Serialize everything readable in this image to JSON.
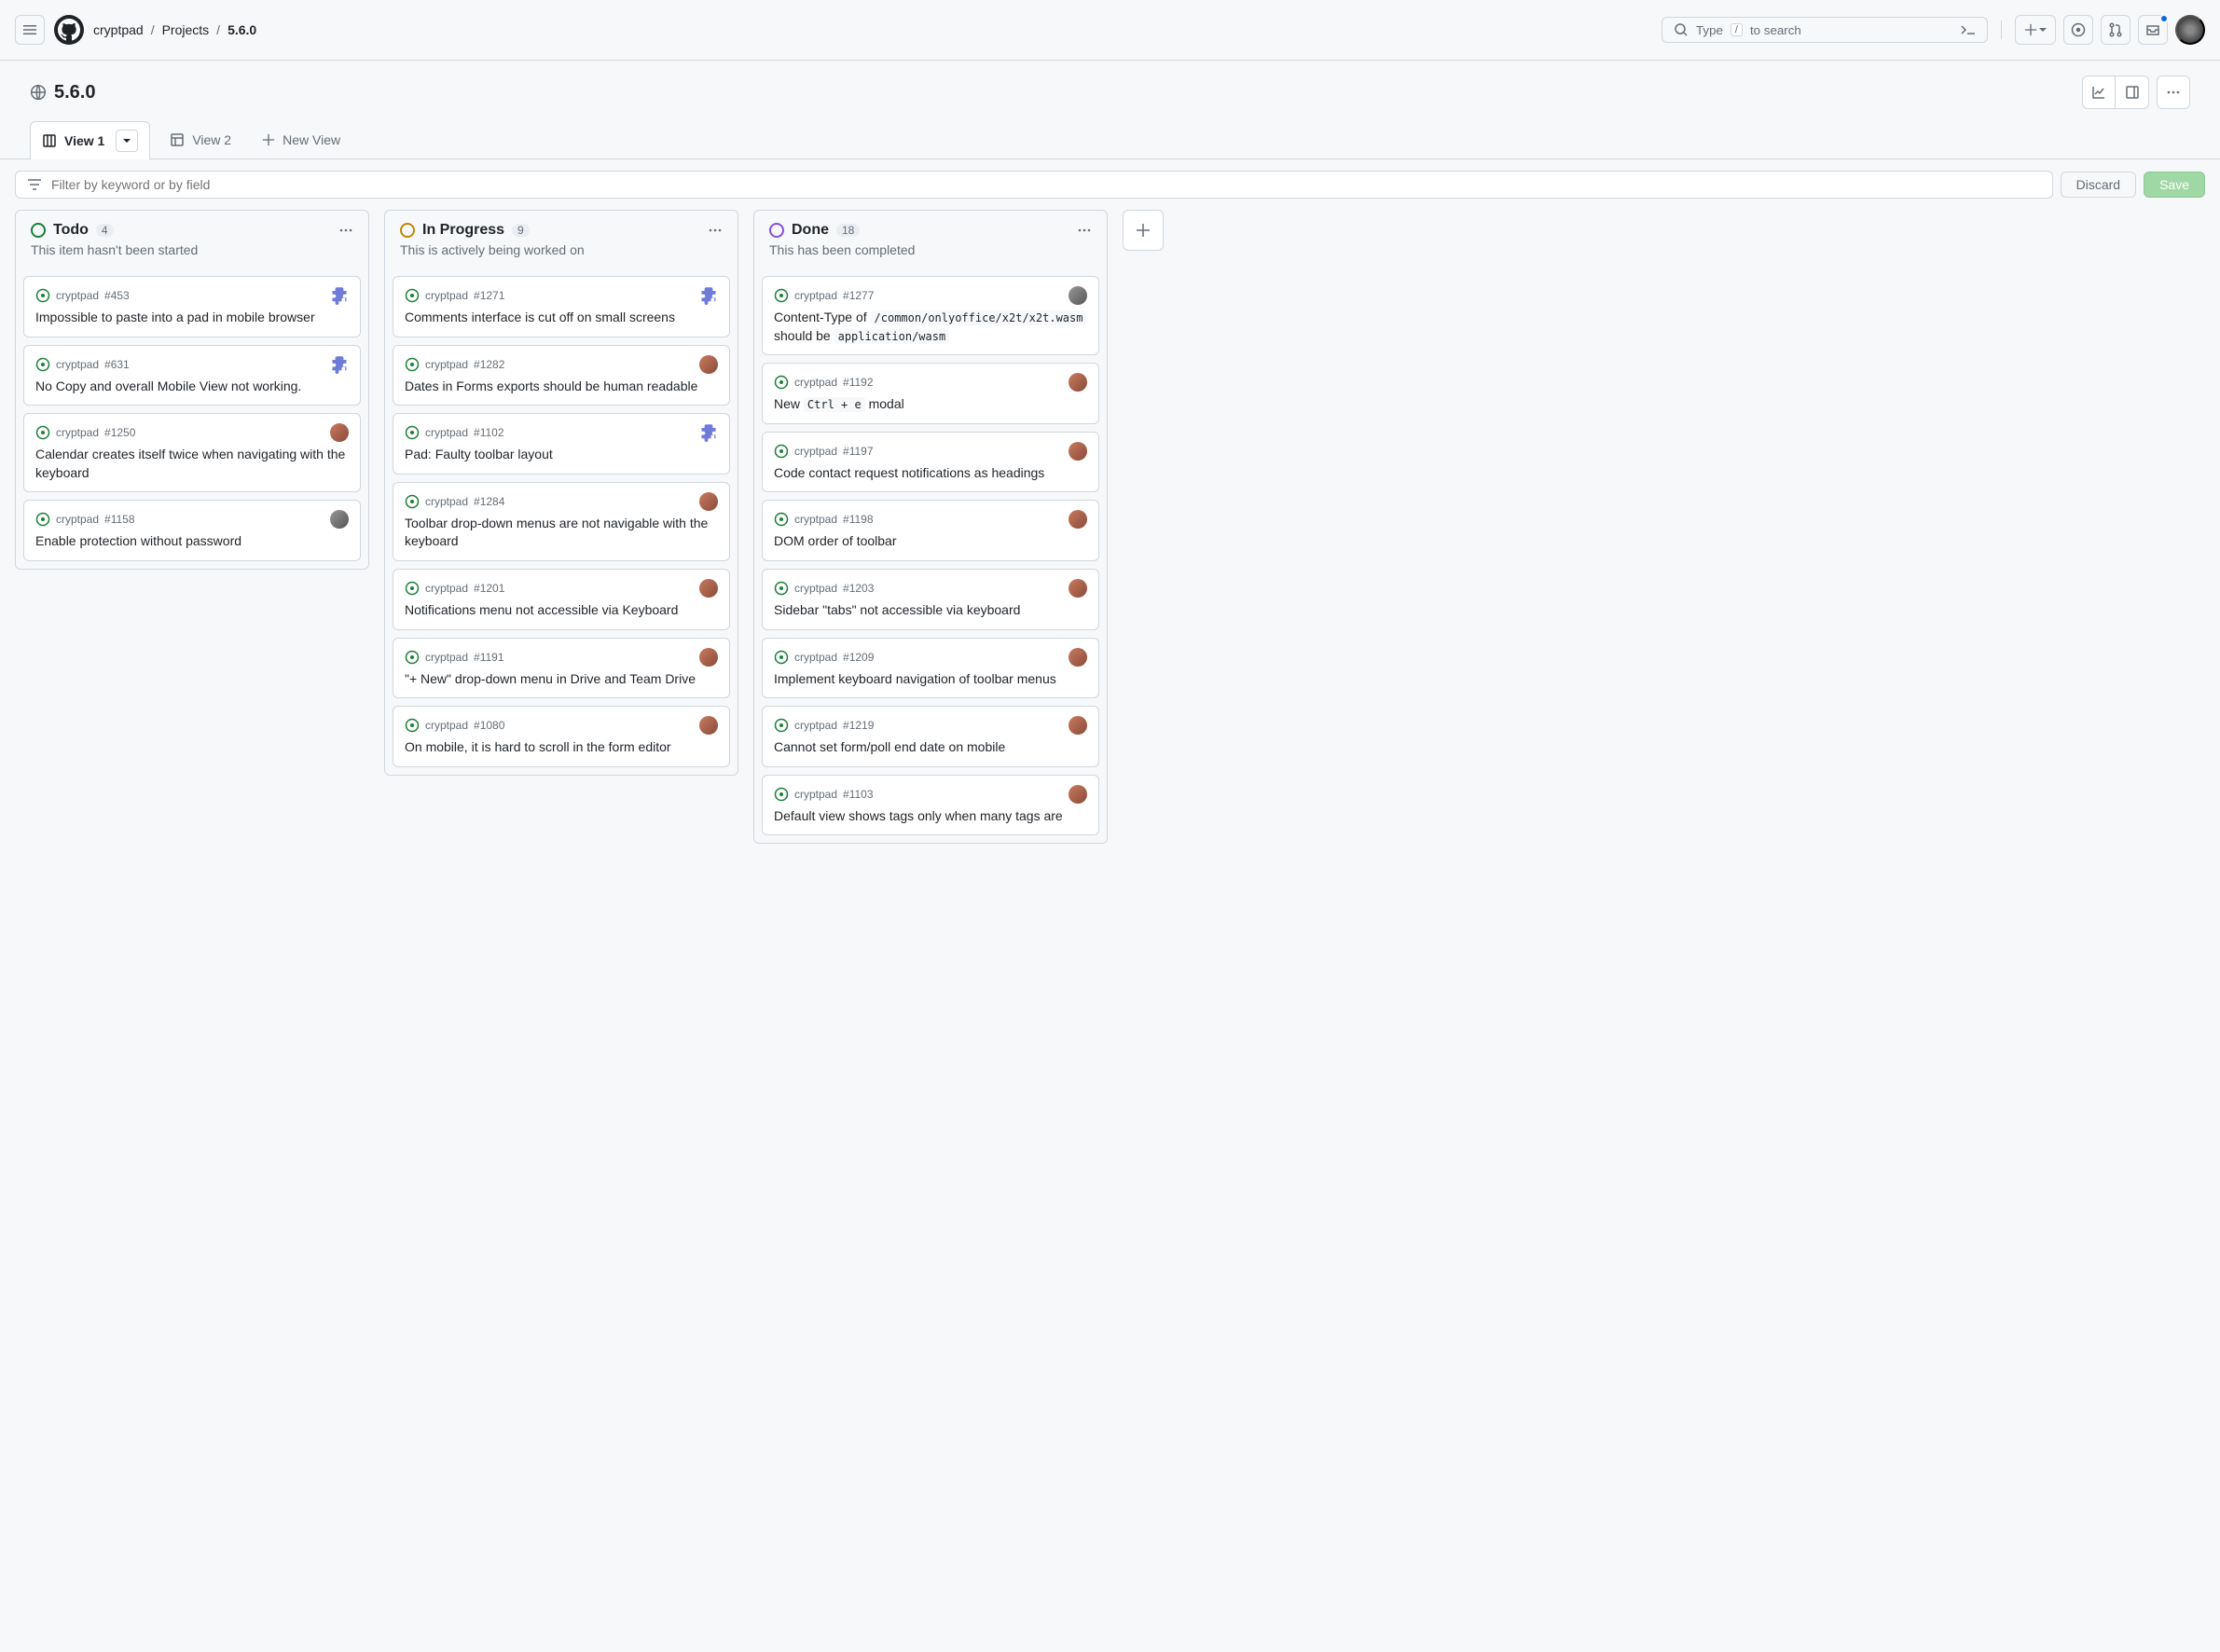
{
  "header": {
    "search_prefix": "Type",
    "search_suffix": "to search",
    "search_key": "/"
  },
  "breadcrumb": {
    "repo": "cryptpad",
    "section": "Projects",
    "current": "5.6.0"
  },
  "project": {
    "title": "5.6.0"
  },
  "tabs": {
    "view1": "View 1",
    "view2": "View 2",
    "new": "New View"
  },
  "filter": {
    "placeholder": "Filter by keyword or by field",
    "discard": "Discard",
    "save": "Save"
  },
  "columns": [
    {
      "id": "todo",
      "title": "Todo",
      "count": "4",
      "desc": "This item hasn't been started",
      "status_class": "sc-todo",
      "cards": [
        {
          "repo": "cryptpad",
          "num": "#453",
          "title": "Impossible to paste into a pad in mobile browser",
          "badge": "puzzle"
        },
        {
          "repo": "cryptpad",
          "num": "#631",
          "title": "No Copy and overall Mobile View not working.",
          "badge": "puzzle"
        },
        {
          "repo": "cryptpad",
          "num": "#1250",
          "title": "Calendar creates itself twice when navigating with the keyboard",
          "badge": "assignee"
        },
        {
          "repo": "cryptpad",
          "num": "#1158",
          "title": "Enable protection without password",
          "badge": "assignee-gray"
        }
      ]
    },
    {
      "id": "progress",
      "title": "In Progress",
      "count": "9",
      "desc": "This is actively being worked on",
      "status_class": "sc-progress",
      "cards": [
        {
          "repo": "cryptpad",
          "num": "#1271",
          "title": "Comments interface is cut off on small screens",
          "badge": "puzzle"
        },
        {
          "repo": "cryptpad",
          "num": "#1282",
          "title": "Dates in Forms exports should be human readable",
          "badge": "assignee"
        },
        {
          "repo": "cryptpad",
          "num": "#1102",
          "title": "Pad: Faulty toolbar layout",
          "badge": "puzzle"
        },
        {
          "repo": "cryptpad",
          "num": "#1284",
          "title": "Toolbar drop-down menus are not navigable with the keyboard",
          "badge": "assignee"
        },
        {
          "repo": "cryptpad",
          "num": "#1201",
          "title": "Notifications menu not accessible via Keyboard",
          "badge": "assignee"
        },
        {
          "repo": "cryptpad",
          "num": "#1191",
          "title": "\"+ New\" drop-down menu in Drive and Team Drive",
          "badge": "assignee"
        },
        {
          "repo": "cryptpad",
          "num": "#1080",
          "title": "On mobile, it is hard to scroll in the form editor",
          "badge": "assignee"
        }
      ]
    },
    {
      "id": "done",
      "title": "Done",
      "count": "18",
      "desc": "This has been completed",
      "status_class": "sc-done",
      "cards": [
        {
          "repo": "cryptpad",
          "num": "#1277",
          "title_html": "Content-Type of <code>/common/onlyoffice/x2t/x2t.wasm</code> should be <code>application/wasm</code>",
          "badge": "assignee-gray"
        },
        {
          "repo": "cryptpad",
          "num": "#1192",
          "title_html": "New <code>Ctrl + e</code> modal",
          "badge": "assignee"
        },
        {
          "repo": "cryptpad",
          "num": "#1197",
          "title": "Code contact request notifications as headings",
          "badge": "assignee"
        },
        {
          "repo": "cryptpad",
          "num": "#1198",
          "title": "DOM order of toolbar",
          "badge": "assignee"
        },
        {
          "repo": "cryptpad",
          "num": "#1203",
          "title": "Sidebar \"tabs\" not accessible via keyboard",
          "badge": "assignee"
        },
        {
          "repo": "cryptpad",
          "num": "#1209",
          "title": "Implement keyboard navigation of toolbar menus",
          "badge": "assignee"
        },
        {
          "repo": "cryptpad",
          "num": "#1219",
          "title": "Cannot set form/poll end date on mobile",
          "badge": "assignee"
        },
        {
          "repo": "cryptpad",
          "num": "#1103",
          "title": "Default view shows tags only when many tags are",
          "badge": "assignee"
        }
      ]
    }
  ]
}
